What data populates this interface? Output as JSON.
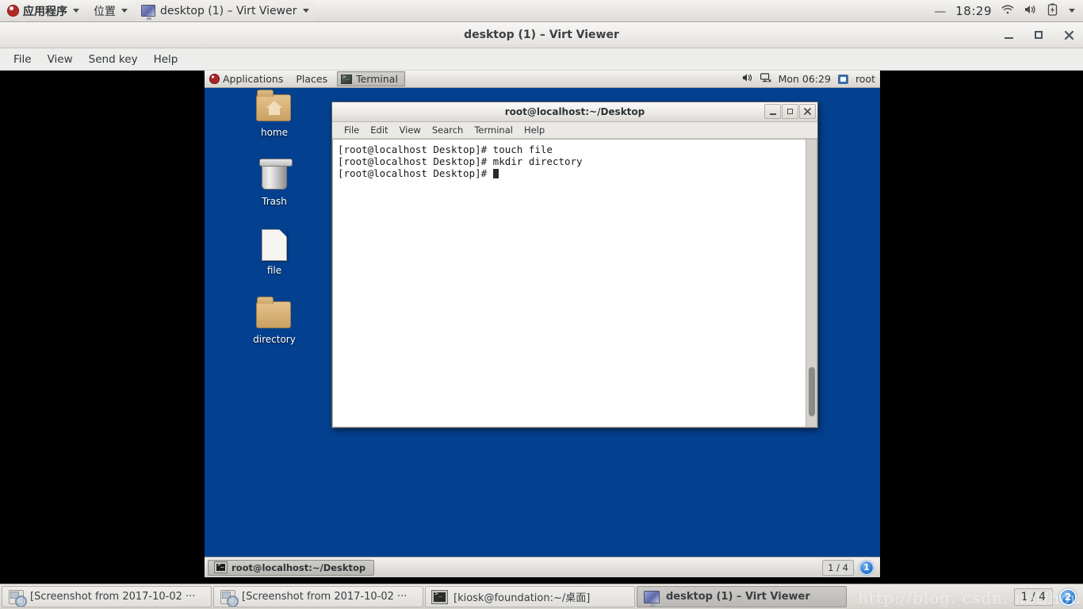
{
  "host_panel": {
    "apps_menu": "应用程序",
    "places_menu": "位置",
    "window_menu": "desktop (1) – Virt Viewer",
    "dash": "—",
    "clock": "18:29",
    "icons": [
      "fedora-logo-icon",
      "wifi-icon",
      "volume-icon",
      "battery-icon",
      "chevron-down-icon"
    ]
  },
  "virt_viewer": {
    "title": "desktop (1) – Virt Viewer",
    "menus": [
      "File",
      "View",
      "Send key",
      "Help"
    ],
    "window_buttons": [
      "minimize",
      "maximize",
      "close"
    ]
  },
  "guest": {
    "top_panel": {
      "applications": "Applications",
      "places": "Places",
      "active_task": "Terminal",
      "clock": "Mon 06:29",
      "user": "root"
    },
    "desktop_icons": [
      {
        "label": "home",
        "icon": "home-folder-icon"
      },
      {
        "label": "Trash",
        "icon": "trash-icon"
      },
      {
        "label": "file",
        "icon": "file-icon"
      },
      {
        "label": "directory",
        "icon": "folder-icon"
      }
    ],
    "terminal": {
      "title": "root@localhost:~/Desktop",
      "menus": [
        "File",
        "Edit",
        "View",
        "Search",
        "Terminal",
        "Help"
      ],
      "lines": [
        "[root@localhost Desktop]# touch file",
        "[root@localhost Desktop]# mkdir directory",
        "[root@localhost Desktop]# "
      ],
      "window_buttons": [
        "minimize",
        "maximize",
        "close"
      ]
    },
    "bottom_panel": {
      "task": "root@localhost:~/Desktop",
      "workspace": "1 / 4",
      "badge": "1"
    },
    "background_color": "#03408f"
  },
  "host_taskbar": {
    "items": [
      {
        "label": "[Screenshot from 2017-10-02 ···",
        "icon": "screenshot-icon",
        "active": false
      },
      {
        "label": "[Screenshot from 2017-10-02 ···",
        "icon": "screenshot-icon",
        "active": false
      },
      {
        "label": "[kiosk@foundation:~/桌面]",
        "icon": "terminal-icon",
        "active": false
      },
      {
        "label": "desktop (1) – Virt Viewer",
        "icon": "virt-viewer-icon",
        "active": true
      }
    ],
    "workspace": "1 / 4",
    "badge": "2"
  },
  "watermark": "http://blog. csdn. net/hou"
}
